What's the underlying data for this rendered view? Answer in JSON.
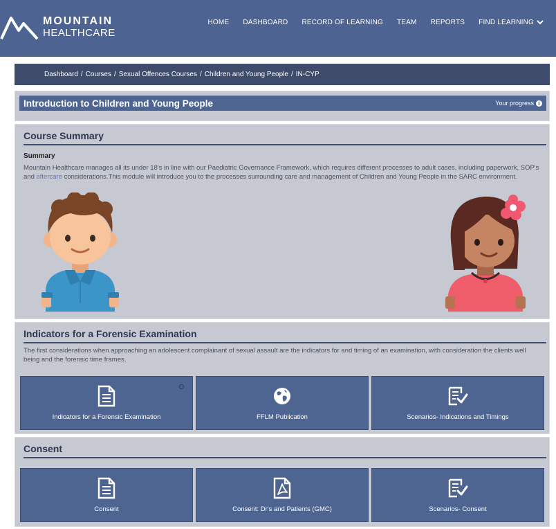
{
  "brand": {
    "line1": "MOUNTAIN",
    "line2": "HEALTHCARE"
  },
  "nav": [
    {
      "label": "HOME"
    },
    {
      "label": "DASHBOARD"
    },
    {
      "label": "RECORD OF LEARNING"
    },
    {
      "label": "TEAM"
    },
    {
      "label": "REPORTS"
    },
    {
      "label": "FIND LEARNING"
    }
  ],
  "breadcrumb": [
    "Dashboard",
    "Courses",
    "Sexual Offences Courses",
    "Children and Young People",
    "IN-CYP"
  ],
  "course": {
    "title": "Introduction to Children and Young People",
    "progress_label": "Your progress"
  },
  "summary": {
    "heading": "Course Summary",
    "subheading": "Summary",
    "text_before_link": "Mountain Healthcare manages all its under 18's in line with our Paediatric Governance Framework, which requires different processes to adult cases, including paperwork, SOP's and ",
    "link": "aftercare",
    "text_after_link": " considerations.This module will introduce you to the processes surrounding care and management of Children and Young People in the SARC environment."
  },
  "indicators": {
    "heading": "Indicators for a Forensic Examination",
    "text": "The first considerations when approaching an adolescent complainant of sexual assault are the indicators for and timing of an examination, with consideration the clients well being and the forensic time frames.",
    "tiles": [
      {
        "label": "Indicators for a Forensic Examination",
        "icon": "document-icon"
      },
      {
        "label": "FFLM Publication",
        "icon": "globe-icon"
      },
      {
        "label": "Scenarios- Indications and Timings",
        "icon": "checklist-icon"
      }
    ]
  },
  "consent": {
    "heading": "Consent",
    "tiles": [
      {
        "label": "Consent",
        "icon": "document-icon"
      },
      {
        "label": "Consent: Dr's and Patients (GMC)",
        "icon": "pdf-icon"
      },
      {
        "label": "Scenarios- Consent",
        "icon": "checklist-icon"
      }
    ]
  },
  "colors": {
    "header": "#4d6492",
    "breadcrumb": "#3e4b6b",
    "panel": "#c6c9d1",
    "tile": "#4e6491"
  }
}
